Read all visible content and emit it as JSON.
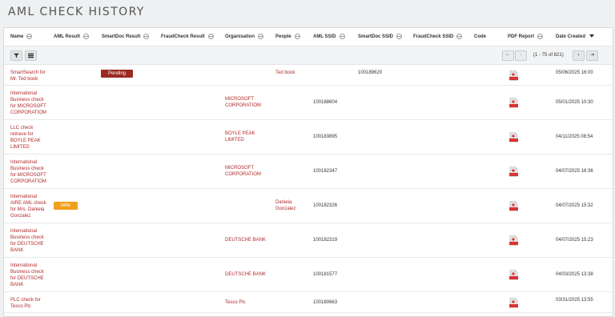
{
  "page_title": "AML CHECK HISTORY",
  "columns": [
    "Name",
    "AML Result",
    "SmartDoc Result",
    "FraudCheck Result",
    "Organisation",
    "People",
    "AML SSID",
    "SmartDoc SSID",
    "FraudCheck SSID",
    "Code",
    "PDF Report",
    "Date Created"
  ],
  "toolbar": {
    "filter_icon": "filter-icon",
    "columns_icon": "list-icon",
    "pagination_info": "(1 - 75 of 821)"
  },
  "colors": {
    "link": "#b12a2a",
    "pending": "#9b2b22",
    "refer": "#f0a020"
  },
  "rows": [
    {
      "name": [
        "SmartSearch for",
        "Mr. Ted book"
      ],
      "aml_result": "",
      "smartdoc_result": "Pending",
      "organisation": [],
      "people": [
        "Ted book"
      ],
      "aml_ssid": "",
      "smartdoc_ssid": "100189620",
      "date": "05/06/2025 16:00"
    },
    {
      "name": [
        "International",
        "Business check",
        "for MICROSOFT",
        "CORPORATIOM"
      ],
      "aml_result": "",
      "smartdoc_result": "",
      "organisation": [
        "MICROSOFT",
        "CORPORATIOM"
      ],
      "people": [],
      "aml_ssid": "100188604",
      "smartdoc_ssid": "",
      "date": "05/01/2025 10:30"
    },
    {
      "name": [
        "LLC check",
        "retrieve for",
        "BOYLE PEAK",
        "LIMITED"
      ],
      "aml_result": "",
      "smartdoc_result": "",
      "organisation": [
        "BOYLE PEAK",
        "LIMITED"
      ],
      "people": [],
      "aml_ssid": "100183895",
      "smartdoc_ssid": "",
      "date": "04/11/2025 08:54"
    },
    {
      "name": [
        "International",
        "Business check",
        "for MICROSOFT",
        "CORPORATIOM"
      ],
      "aml_result": "",
      "smartdoc_result": "",
      "organisation": [
        "MICROSOFT",
        "CORPORATIOM"
      ],
      "people": [],
      "aml_ssid": "100182347",
      "smartdoc_ssid": "",
      "date": "04/07/2025 16:36"
    },
    {
      "name": [
        "International",
        "AIRE AML check",
        "for Mrs. Danieia",
        "Gonzalez"
      ],
      "aml_result": "refer",
      "smartdoc_result": "",
      "organisation": [],
      "people": [
        "Danieia",
        "Gonzalez"
      ],
      "aml_ssid": "100182326",
      "smartdoc_ssid": "",
      "date": "04/07/2025 15:32"
    },
    {
      "name": [
        "International",
        "Business check",
        "for DEUTSCHE",
        "BANK"
      ],
      "aml_result": "",
      "smartdoc_result": "",
      "organisation": [
        "DEUTSCHE BANK"
      ],
      "people": [],
      "aml_ssid": "100182319",
      "smartdoc_ssid": "",
      "date": "04/07/2025 15:23"
    },
    {
      "name": [
        "International",
        "Business check",
        "for DEUTSCHE",
        "BANK"
      ],
      "aml_result": "",
      "smartdoc_result": "",
      "organisation": [
        "DEUTSCHE BANK"
      ],
      "people": [],
      "aml_ssid": "100181577",
      "smartdoc_ssid": "",
      "date": "04/03/2025 13:38"
    },
    {
      "name": [
        "PLC check for",
        "Tesco Plc"
      ],
      "aml_result": "",
      "smartdoc_result": "",
      "organisation": [
        "Tesco Plc"
      ],
      "people": [],
      "aml_ssid": "100180663",
      "smartdoc_ssid": "",
      "date": "03/31/2025 13:55"
    }
  ]
}
